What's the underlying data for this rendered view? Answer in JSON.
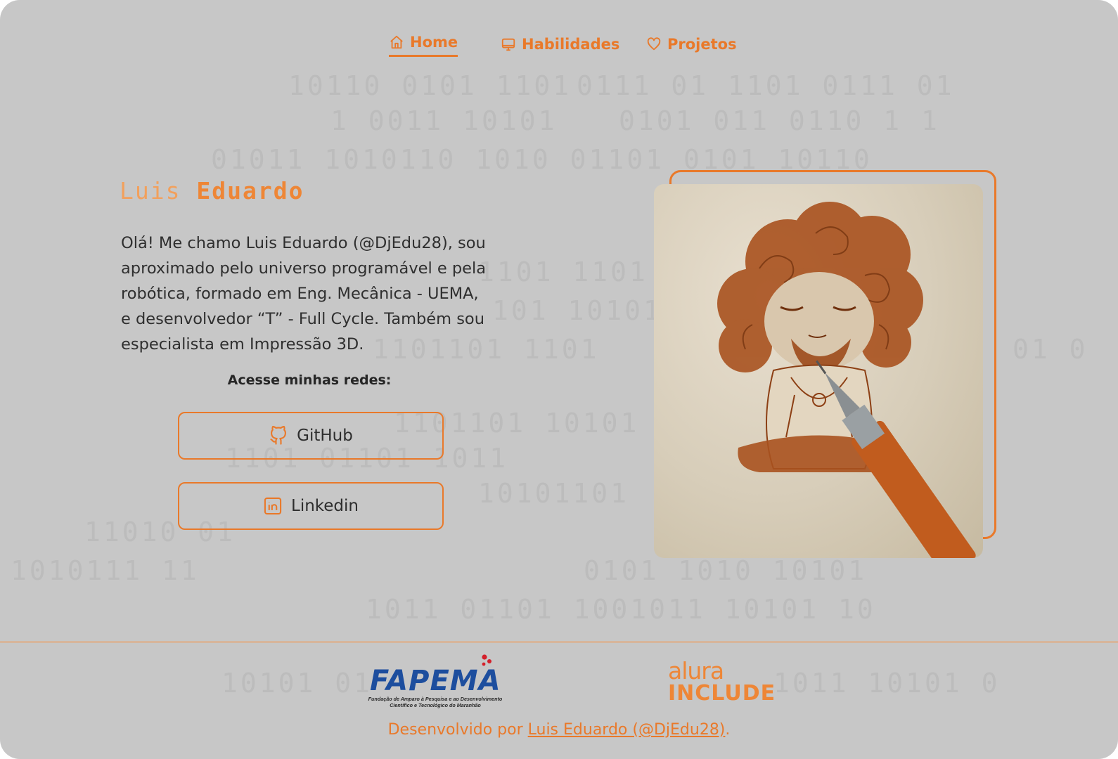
{
  "nav": {
    "items": [
      {
        "label": "Home",
        "icon": "home-icon",
        "active": true
      },
      {
        "label": "Habilidades",
        "icon": "monitor-icon",
        "active": false
      },
      {
        "label": "Projetos",
        "icon": "heart-icon",
        "active": false
      }
    ]
  },
  "hero": {
    "name_first": "Luis",
    "name_last": "Eduardo",
    "bio": "Olá! Me chamo Luis Eduardo (@DjEdu28), sou aproximado pelo universo programável e pela robótica, formado em Eng. Mecânica - UEMA, e desenvolvedor “T” - Full Cycle. Também sou especialista em Impressão 3D.",
    "social_title": "Acesse minhas redes:",
    "social_buttons": [
      {
        "label": "GitHub",
        "icon": "github-icon"
      },
      {
        "label": "Linkedin",
        "icon": "linkedin-icon"
      }
    ]
  },
  "footer": {
    "fapema_logo": "FAPEMA",
    "fapema_subtitle_line1": "Fundação de Amparo à Pesquisa e ao Desenvolvimento",
    "fapema_subtitle_line2": "Científico e Tecnológico do Maranhão",
    "alura_top": "alura",
    "alura_bottom": "INCLUDE",
    "credits_prefix": "Desenvolvido por ",
    "credits_link": "Luis Eduardo (@DjEdu28)",
    "credits_suffix": "."
  },
  "colors": {
    "accent": "#e9792a",
    "background": "#c7c7c7",
    "text": "#2f2f2f",
    "fapema_blue": "#1d4e9e"
  }
}
